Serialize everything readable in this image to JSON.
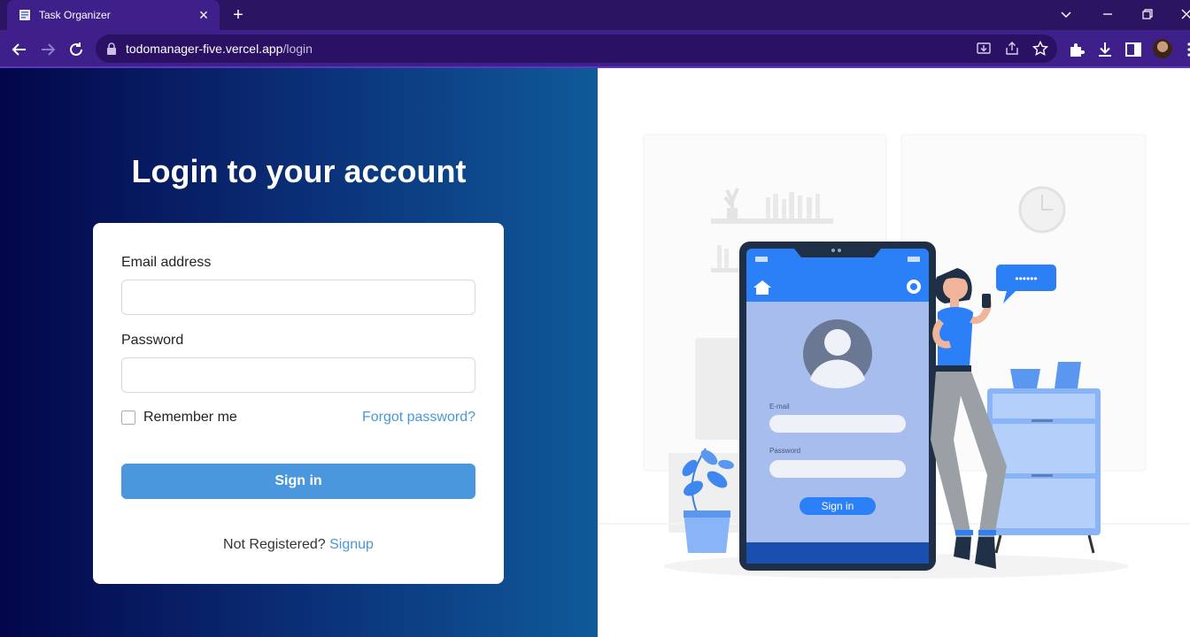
{
  "browser": {
    "tab_title": "Task Organizer",
    "url_host": "todomanager-five.vercel.app",
    "url_path": "/login"
  },
  "login": {
    "heading": "Login to your account",
    "email_label": "Email address",
    "email_value": "",
    "password_label": "Password",
    "password_value": "",
    "remember_label": "Remember me",
    "remember_checked": false,
    "forgot_label": "Forgot password?",
    "signin_label": "Sign in",
    "not_registered_text": "Not Registered?",
    "signup_label": "Signup"
  },
  "illustration": {
    "phone_email_label": "E-mail",
    "phone_password_label": "Password",
    "phone_signin_label": "Sign in",
    "bubble_text": "••••••"
  },
  "colors": {
    "brand_purple": "#3f208a",
    "gradient_start": "#03064a",
    "gradient_end": "#0f5a9a",
    "button_blue": "#4a97de",
    "link_blue": "#4a97d4"
  }
}
